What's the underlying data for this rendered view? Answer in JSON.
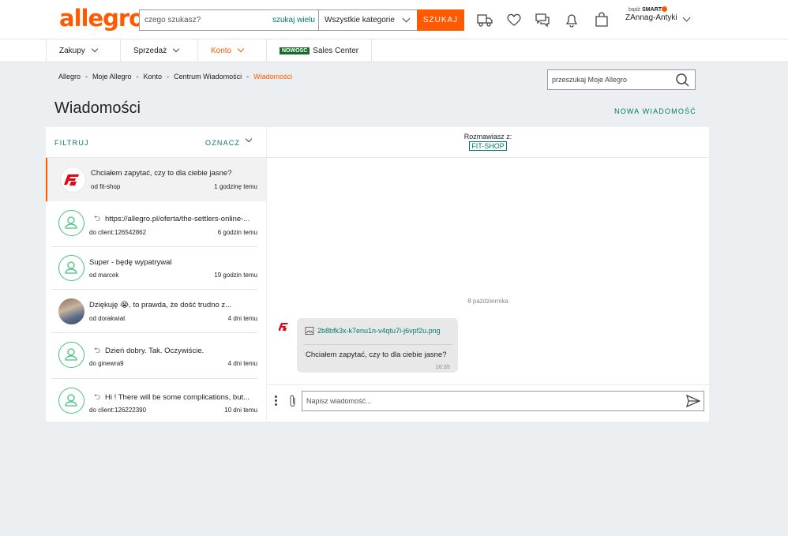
{
  "header": {
    "logo": "allegro",
    "search_placeholder": "czego szukasz?",
    "search_many": "szukaj wielu",
    "category": "Wszystkie kategorie",
    "search_button": "SZUKAJ",
    "smart_prefix": "bądź",
    "smart_label": "SMART",
    "username": "ZAnnag-Antyki"
  },
  "nav": {
    "items": [
      {
        "label": "Zakupy"
      },
      {
        "label": "Sprzedaż"
      },
      {
        "label": "Konto"
      }
    ],
    "new_badge": "NOWOŚĆ",
    "sales_center": "Sales Center"
  },
  "breadcrumb": [
    "Allegro",
    "Moje Allegro",
    "Konto",
    "Centrum Wiadomości",
    "Wiadomości"
  ],
  "breadcrumb_sep": "-",
  "my_search_placeholder": "przeszukaj Moje Allegro",
  "page_title": "Wiadomości",
  "new_message": "NOWA WIADOMOŚĆ",
  "list": {
    "filter": "FILTRUJ",
    "mark": "OZNACZ",
    "threads": [
      {
        "subject": "Chciałem zapytać, czy to dla ciebie jasne?",
        "from": "od fit-shop",
        "time": "1 godzinę temu",
        "reply": false
      },
      {
        "subject": "https://allegro.pl/oferta/the-settlers-online-...",
        "from": "do client:126542862",
        "time": "6 godzin temu",
        "reply": true
      },
      {
        "subject": "Super - będę wypatrywal",
        "from": "od marcek",
        "time": "19 godzin temu",
        "reply": false
      },
      {
        "subject": "Dziękuję 😭, to prawda, że dość trudno z...",
        "from": "od dorakwiat",
        "time": "4 dni temu",
        "reply": false
      },
      {
        "subject": "Dzień dobry. Tak. Oczywiście.",
        "from": "do ginewra9",
        "time": "4 dni temu",
        "reply": true
      },
      {
        "subject": "Hi ! There will be some complications, but...",
        "from": "do client:126222390",
        "time": "10 dni temu",
        "reply": true
      }
    ]
  },
  "conversation": {
    "with_label": "Rozmawiasz z:",
    "with_name": "FIT-SHOP",
    "date": "8 października",
    "attachment": "2b8bfk3x-k7enu1n-v4qtu7i-j6vpf2u.png",
    "message": "Chciałem zapytać, czy to dla ciebie jasne?",
    "message_time": "16:35",
    "input_placeholder": "Napisz wiadomość..."
  },
  "colors": {
    "brand": "#ff5a00",
    "accent": "#00796b",
    "avatar_ring": "#46c37b",
    "fitshop_red": "#e30613"
  }
}
